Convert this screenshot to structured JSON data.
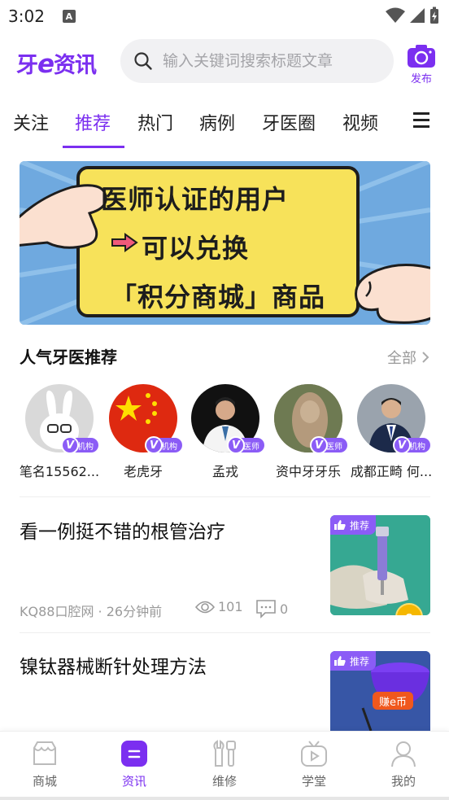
{
  "status": {
    "time": "3:02",
    "notification_icon": "A"
  },
  "header": {
    "logo_prefix": "牙",
    "logo_e": "e",
    "logo_suffix": "资讯",
    "search_placeholder": "输入关键词搜索标题文章",
    "publish_label": "发布",
    "accent_color": "#7b2ff0"
  },
  "tabs": [
    {
      "label": "关注"
    },
    {
      "label": "推荐",
      "active": true
    },
    {
      "label": "热门"
    },
    {
      "label": "病例"
    },
    {
      "label": "牙医圈"
    },
    {
      "label": "视频"
    }
  ],
  "banner": {
    "line1": "医师认证的用户",
    "line2": "可以兑换",
    "line3": "「积分商城」商品"
  },
  "dentists_section": {
    "title": "人气牙医推荐",
    "more_label": "全部",
    "items": [
      {
        "name": "笔名15562...",
        "badge": "机构"
      },
      {
        "name": "老虎牙",
        "badge": "机构"
      },
      {
        "name": "孟戎",
        "badge": "医师"
      },
      {
        "name": "资中牙牙乐",
        "badge": "医师"
      },
      {
        "name": "成都正畸 何...",
        "badge": "机构"
      }
    ]
  },
  "articles": [
    {
      "title": "看一例挺不错的根管治疗",
      "source": "KQ88口腔网 · 26分钟前",
      "views": "101",
      "comments": "0",
      "tag": "推荐"
    },
    {
      "title": "镍钛器械断针处理方法",
      "tag": "推荐",
      "earn_label": "赚e币"
    }
  ],
  "bottom_nav": [
    {
      "label": "商城",
      "icon": "shop-icon"
    },
    {
      "label": "资讯",
      "icon": "news-icon",
      "active": true
    },
    {
      "label": "维修",
      "icon": "wrench-icon"
    },
    {
      "label": "学堂",
      "icon": "tv-icon"
    },
    {
      "label": "我的",
      "icon": "person-icon"
    }
  ]
}
